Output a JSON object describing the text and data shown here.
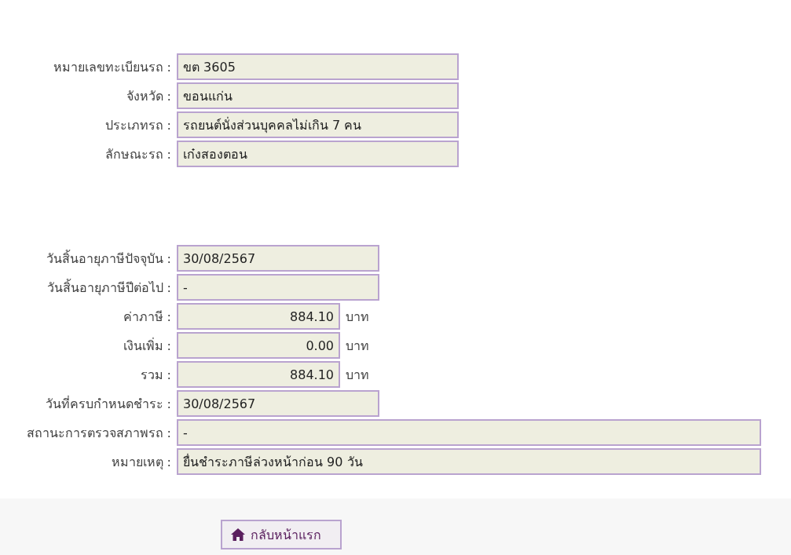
{
  "vehicle": [
    {
      "label": "หมายเลขทะเบียนรถ :",
      "value": "ขต 3605",
      "kind": "medium"
    },
    {
      "label": "จังหวัด :",
      "value": "ขอนแก่น",
      "kind": "medium"
    },
    {
      "label": "ประเภทรถ :",
      "value": "รถยนต์นั่งส่วนบุคคลไม่เกิน 7 คน",
      "kind": "medium"
    },
    {
      "label": "ลักษณะรถ :",
      "value": "เก๋งสองตอน",
      "kind": "medium"
    }
  ],
  "tax": [
    {
      "label": "วันสิ้นอายุภาษีปัจจุบัน :",
      "value": "30/08/2567",
      "kind": "date"
    },
    {
      "label": "วันสิ้นอายุภาษีปีต่อไป :",
      "value": "-",
      "kind": "date"
    },
    {
      "label": "ค่าภาษี :",
      "value": "884.10",
      "kind": "amount",
      "unit": "บาท"
    },
    {
      "label": "เงินเพิ่ม :",
      "value": "0.00",
      "kind": "amount",
      "unit": "บาท"
    },
    {
      "label": "รวม :",
      "value": "884.10",
      "kind": "amount",
      "unit": "บาท"
    },
    {
      "label": "วันที่ครบกำหนดชำระ :",
      "value": "30/08/2567",
      "kind": "date"
    },
    {
      "label": "สถานะการตรวจสภาพรถ :",
      "value": "-",
      "kind": "full"
    },
    {
      "label": "หมายเหตุ :",
      "value": "ยื่นชำระภาษีล่วงหน้าก่อน  90 วัน",
      "kind": "full"
    }
  ],
  "footer": {
    "button": "กลับหน้าแรก"
  }
}
